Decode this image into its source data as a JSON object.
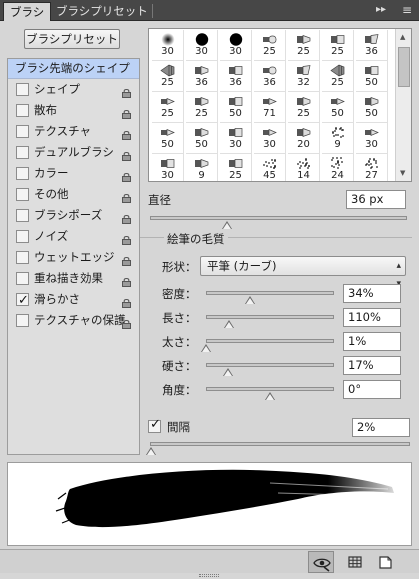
{
  "tabs": [
    {
      "label": "ブラシ",
      "active": true
    },
    {
      "label": "ブラシプリセット",
      "active": false
    }
  ],
  "tab_controls": {
    "collapse": "▸▸",
    "menu": "≡"
  },
  "preset_button": "ブラシプリセット",
  "sidebar": {
    "header": "ブラシ先端のシェイプ",
    "items": [
      {
        "label": "シェイプ",
        "checked": false,
        "locked": true
      },
      {
        "label": "散布",
        "checked": false,
        "locked": true
      },
      {
        "label": "テクスチャ",
        "checked": false,
        "locked": true
      },
      {
        "label": "デュアルブラシ",
        "checked": false,
        "locked": true
      },
      {
        "label": "カラー",
        "checked": false,
        "locked": true
      },
      {
        "label": "その他",
        "checked": false,
        "locked": true
      },
      {
        "label": "ブラシポーズ",
        "checked": false,
        "locked": true
      },
      {
        "label": "ノイズ",
        "checked": false,
        "locked": true
      },
      {
        "label": "ウェットエッジ",
        "checked": false,
        "locked": true
      },
      {
        "label": "重ね描き効果",
        "checked": false,
        "locked": true
      },
      {
        "label": "滑らかさ",
        "checked": true,
        "locked": true
      },
      {
        "label": "テクスチャの保護",
        "checked": false,
        "locked": true
      }
    ]
  },
  "brush_grid": {
    "rows": [
      [
        {
          "size": "30",
          "icon": "soft-round-brush-icon"
        },
        {
          "size": "30",
          "icon": "hard-round-brush-icon"
        },
        {
          "size": "30",
          "icon": "hard-round-brush-icon"
        },
        {
          "size": "25",
          "icon": "round-blunt-bristle-icon"
        },
        {
          "size": "25",
          "icon": "flat-point-bristle-icon"
        },
        {
          "size": "25",
          "icon": "flat-blunt-bristle-icon"
        },
        {
          "size": "36",
          "icon": "flat-angle-bristle-icon"
        }
      ],
      [
        {
          "size": "25",
          "icon": "fan-bristle-icon"
        },
        {
          "size": "36",
          "icon": "flat-point-bristle-icon"
        },
        {
          "size": "36",
          "icon": "flat-blunt-bristle-icon"
        },
        {
          "size": "36",
          "icon": "round-blunt-bristle-icon"
        },
        {
          "size": "32",
          "icon": "flat-angle-bristle-icon"
        },
        {
          "size": "25",
          "icon": "fan-bristle-icon"
        },
        {
          "size": "50",
          "icon": "flat-blunt-bristle-icon"
        }
      ],
      [
        {
          "size": "25",
          "icon": "round-point-bristle-icon"
        },
        {
          "size": "25",
          "icon": "flat-point-bristle-icon"
        },
        {
          "size": "50",
          "icon": "flat-blunt-bristle-icon"
        },
        {
          "size": "71",
          "icon": "round-point-bristle-icon"
        },
        {
          "size": "25",
          "icon": "flat-point-bristle-icon"
        },
        {
          "size": "50",
          "icon": "round-point-bristle-icon"
        },
        {
          "size": "50",
          "icon": "flat-point-bristle-icon"
        }
      ],
      [
        {
          "size": "50",
          "icon": "round-point-bristle-icon"
        },
        {
          "size": "50",
          "icon": "flat-point-bristle-icon"
        },
        {
          "size": "30",
          "icon": "flat-blunt-bristle-icon"
        },
        {
          "size": "30",
          "icon": "round-point-bristle-icon"
        },
        {
          "size": "20",
          "icon": "flat-point-bristle-icon"
        },
        {
          "size": "9",
          "icon": "scatter-brush-icon"
        },
        {
          "size": "30",
          "icon": "round-point-bristle-icon"
        }
      ],
      [
        {
          "size": "30",
          "icon": "flat-blunt-bristle-icon"
        },
        {
          "size": "9",
          "icon": "flat-point-bristle-icon"
        },
        {
          "size": "25",
          "icon": "flat-blunt-bristle-icon"
        },
        {
          "size": "45",
          "icon": "scatter-brush-icon"
        },
        {
          "size": "14",
          "icon": "scatter-brush-icon"
        },
        {
          "size": "24",
          "icon": "scatter-brush-icon"
        },
        {
          "size": "27",
          "icon": "scatter-brush-icon"
        }
      ]
    ]
  },
  "diameter": {
    "label": "直径",
    "value": "36 px",
    "slider_fraction": 0.3
  },
  "bristle": {
    "title": "絵筆の毛質",
    "shape_label": "形状：",
    "shape_value": "平筆 (カーブ)",
    "params": [
      {
        "label": "密度：",
        "value": "34%",
        "fraction": 0.34
      },
      {
        "label": "長さ：",
        "value": "110%",
        "fraction": 0.18
      },
      {
        "label": "太さ：",
        "value": "1%",
        "fraction": 0.0
      },
      {
        "label": "硬さ：",
        "value": "17%",
        "fraction": 0.17
      },
      {
        "label": "角度：",
        "value": "0°",
        "fraction": 0.5
      }
    ]
  },
  "spacing": {
    "label": "間隔",
    "checked": true,
    "value": "2%",
    "slider_fraction": 0.0
  },
  "bottom_icons": [
    "bristle-preview-icon",
    "grid-icon",
    "new-brush-icon"
  ]
}
